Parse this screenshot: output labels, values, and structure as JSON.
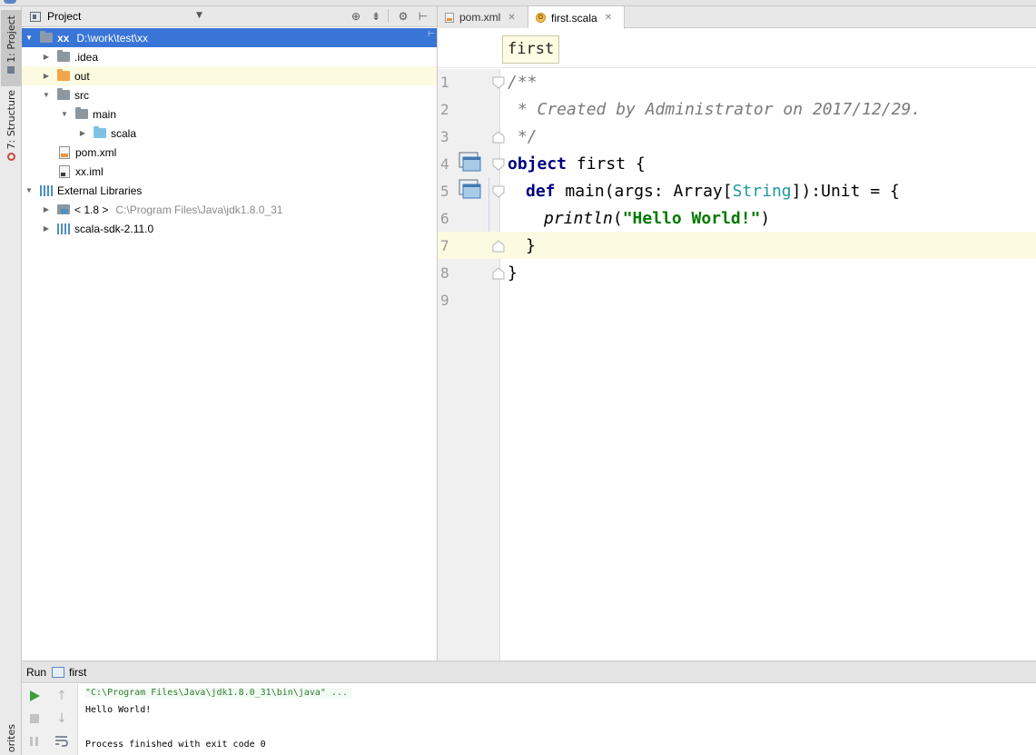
{
  "sidebar": {
    "project_tab": "1: Project",
    "structure_tab": "7: Structure",
    "favorites_tab": "orites"
  },
  "project_panel": {
    "title": "Project",
    "tree": [
      {
        "label": "xx",
        "detail": "D:\\work\\test\\xx",
        "state": "selected"
      },
      {
        "label": ".idea"
      },
      {
        "label": "out"
      },
      {
        "label": "src"
      },
      {
        "label": "main"
      },
      {
        "label": "scala"
      },
      {
        "label": "pom.xml"
      },
      {
        "label": "xx.iml"
      },
      {
        "label": "External Libraries"
      },
      {
        "label": "< 1.8 >",
        "detail": "C:\\Program Files\\Java\\jdk1.8.0_31"
      },
      {
        "label": "scala-sdk-2.11.0"
      }
    ]
  },
  "editor": {
    "tabs": [
      {
        "label": "pom.xml",
        "active": false
      },
      {
        "label": "first.scala",
        "active": true
      }
    ],
    "breadcrumb": "first",
    "line_numbers": [
      "1",
      "2",
      "3",
      "4",
      "5",
      "6",
      "7",
      "8",
      "9"
    ],
    "code": {
      "l1": "/**",
      "l2": " * Created by Administrator on 2017/12/29.",
      "l3": " */",
      "l4_kw": "object",
      "l4_rest": " first {",
      "l5_kw": "def",
      "l5_a": " main(args: Array[",
      "l5_type": "String",
      "l5_b": "]):Unit = {",
      "l6_fn": "println",
      "l6_open": "(",
      "l6_str": "\"Hello World!\"",
      "l6_close": ")",
      "l7": "}",
      "l8": "}"
    },
    "current_line": 7
  },
  "run_panel": {
    "label": "Run",
    "config": "first",
    "console": {
      "command": "\"C:\\Program Files\\Java\\jdk1.8.0_31\\bin\\java\" ...",
      "output": "Hello World!",
      "exit": "Process finished with exit code 0"
    }
  },
  "colors": {
    "selection": "#3875d7",
    "keyword": "#000080",
    "string": "#007a00",
    "comment": "#7a7a7a",
    "type": "#20999d",
    "current_line": "#fcfae0"
  }
}
